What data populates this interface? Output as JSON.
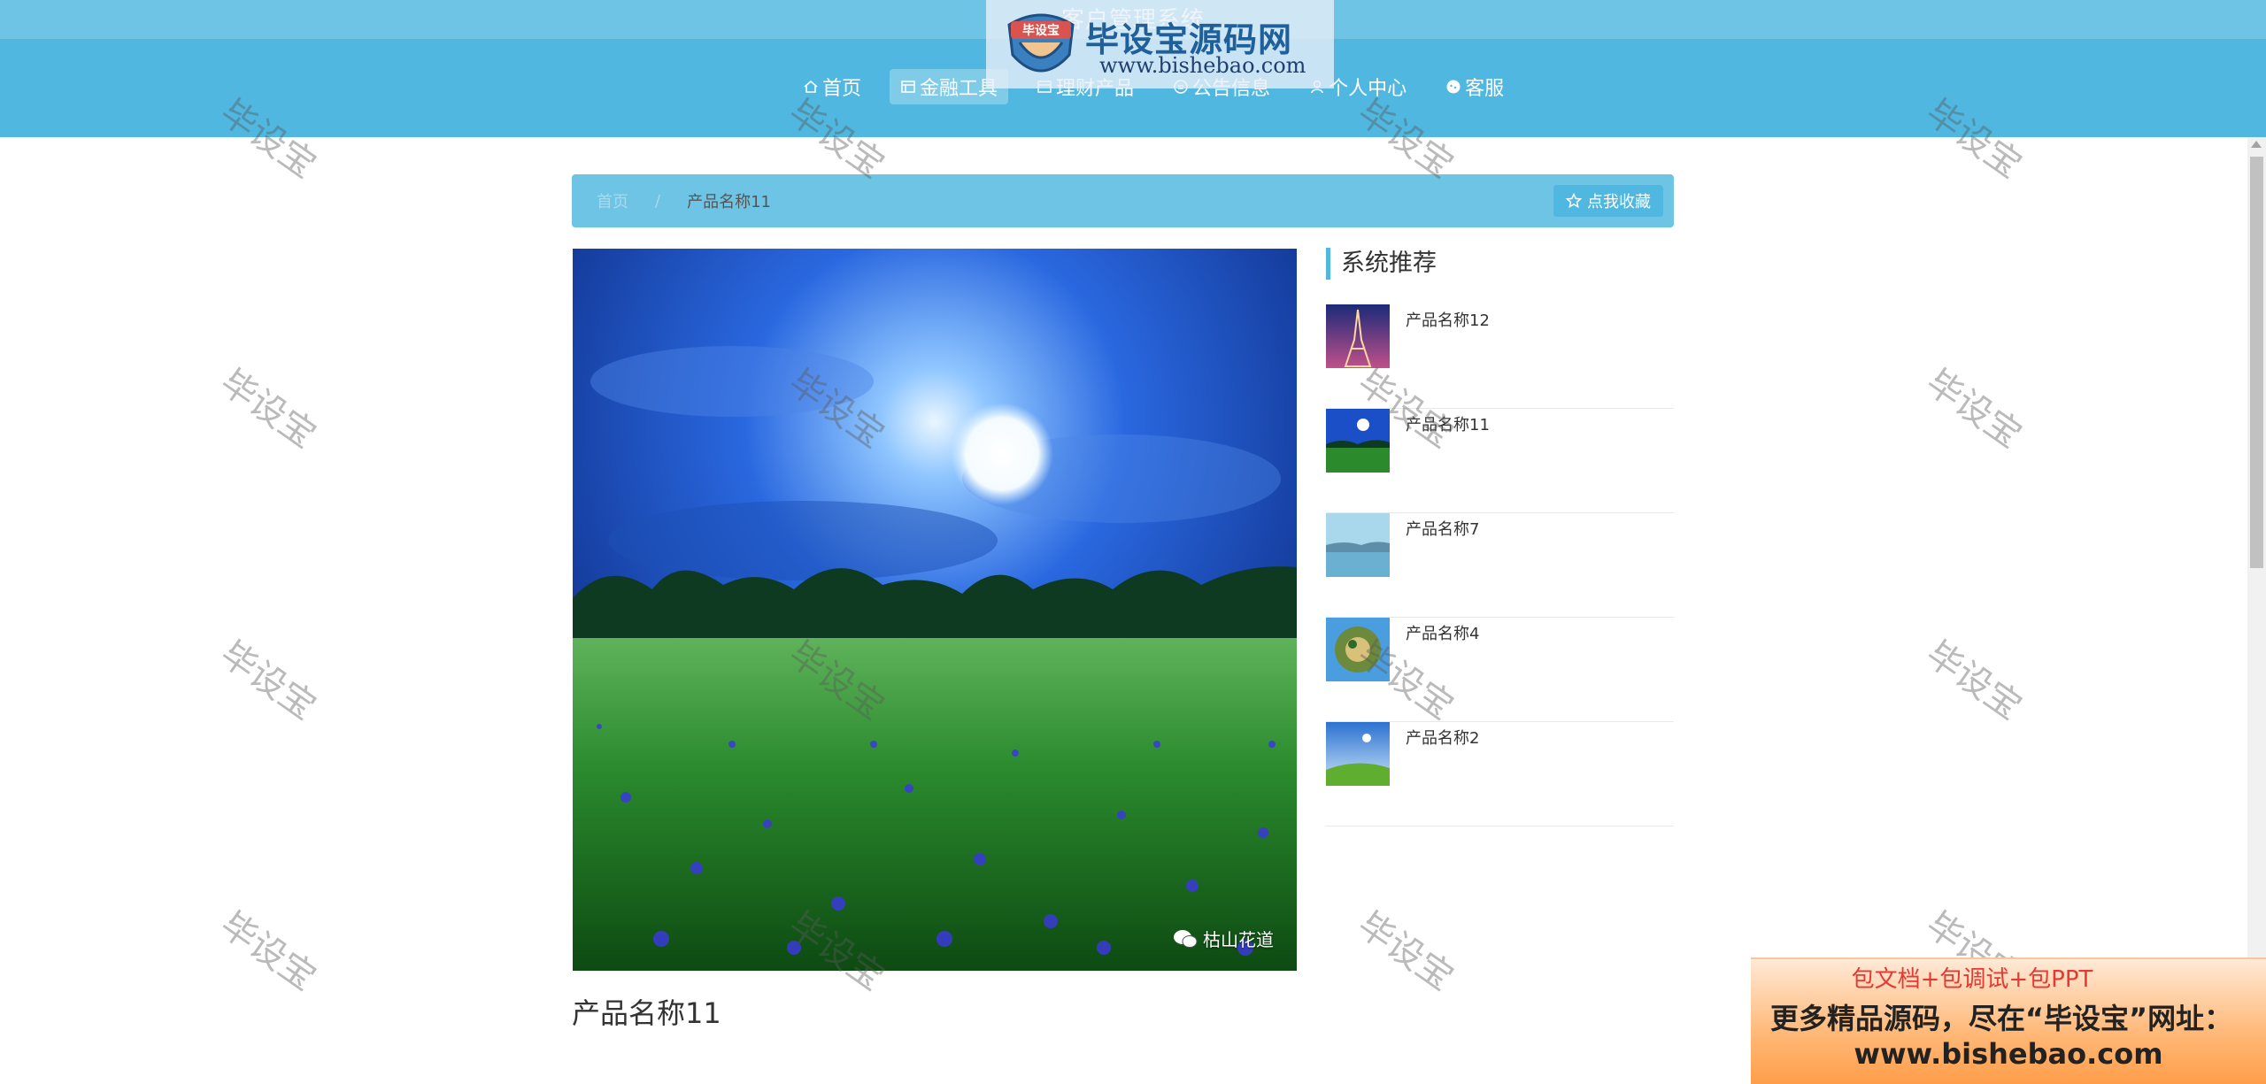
{
  "header": {
    "system_title": "客户管理系统",
    "nav": [
      {
        "label": "首页",
        "icon": "home-icon",
        "active": false
      },
      {
        "label": "金融工具",
        "icon": "grid-icon",
        "active": true
      },
      {
        "label": "理财产品",
        "icon": "grid-icon",
        "active": false
      },
      {
        "label": "公告信息",
        "icon": "bell-icon",
        "active": false
      },
      {
        "label": "个人中心",
        "icon": "user-icon",
        "active": false
      },
      {
        "label": "客服",
        "icon": "chat-icon",
        "active": false
      }
    ]
  },
  "logo_watermark": {
    "badge_text": "毕设宝",
    "brand": "毕设宝源码网",
    "url": "www.bishebao.com"
  },
  "breadcrumb": {
    "home": "首页",
    "separator": "/",
    "current": "产品名称11",
    "favorite_button": "点我收藏"
  },
  "product": {
    "name": "产品名称11",
    "image_caption": "枯山花道"
  },
  "recommend": {
    "title": "系统推荐",
    "items": [
      {
        "label": "产品名称12",
        "thumb": "eiffel-tower"
      },
      {
        "label": "产品名称11",
        "thumb": "moon-meadow"
      },
      {
        "label": "产品名称7",
        "thumb": "lake"
      },
      {
        "label": "产品名称4",
        "thumb": "tiny-planet"
      },
      {
        "label": "产品名称2",
        "thumb": "sky-field"
      }
    ]
  },
  "watermark_text": "毕设宝",
  "promo": {
    "line1": "包文档+包调试+包PPT",
    "line2": "更多精品源码，尽在“毕设宝”网址：",
    "line3": "www.bishebao.com"
  },
  "colors": {
    "topbar": "#6ec4e4",
    "navbar": "#4fb7e0",
    "accent": "#4fb7e0",
    "promo_red": "#e53935"
  }
}
